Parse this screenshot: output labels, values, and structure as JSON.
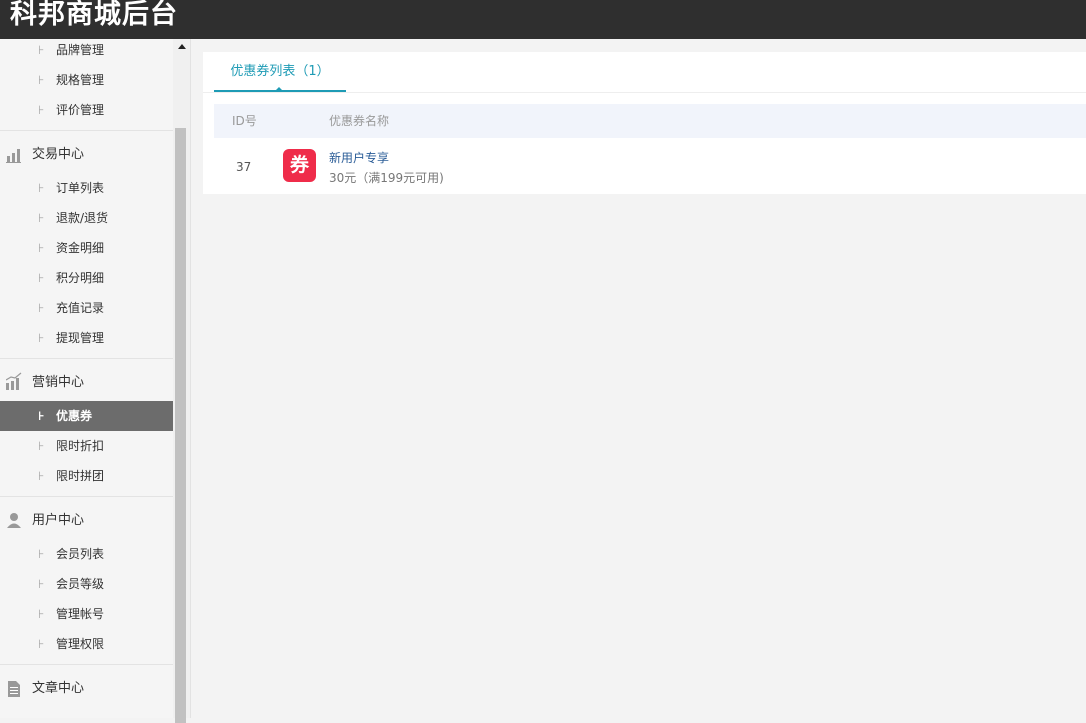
{
  "header": {
    "brand": "科邦商城后台"
  },
  "sidebar": {
    "items_top": [
      "品牌管理",
      "规格管理",
      "评价管理"
    ],
    "trade": {
      "title": "交易中心",
      "icon": "bar-chart-icon",
      "items": [
        "订单列表",
        "退款/退货",
        "资金明细",
        "积分明细",
        "充值记录",
        "提现管理"
      ]
    },
    "marketing": {
      "title": "营销中心",
      "icon": "growth-chart-icon",
      "items": [
        "优惠券",
        "限时折扣",
        "限时拼团"
      ],
      "active": "优惠券"
    },
    "user": {
      "title": "用户中心",
      "icon": "user-icon",
      "items": [
        "会员列表",
        "会员等级",
        "管理帐号",
        "管理权限"
      ]
    },
    "article": {
      "title": "文章中心",
      "icon": "document-icon"
    },
    "tick": "⊦"
  },
  "main": {
    "tab_label": "优惠券列表（1）",
    "columns": [
      "ID号",
      "优惠券名称"
    ],
    "rows": [
      {
        "id": "37",
        "badge": "券",
        "name": "新用户专享",
        "desc": "30元（满199元可用)"
      }
    ]
  },
  "colors": {
    "accent": "#1e9bb5",
    "badge": "#ef2c4a",
    "topbar": "#2f2f2f",
    "active_nav": "#6c6c6c"
  }
}
